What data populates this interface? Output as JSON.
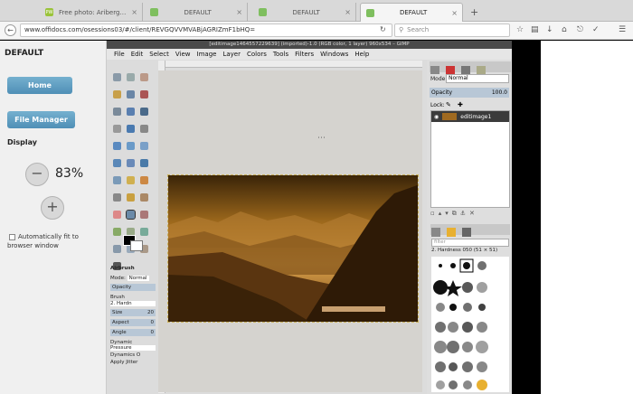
{
  "browser": {
    "tabs": [
      {
        "title": "Free photo: Ariberg Pass, L...",
        "favicon": "pw"
      },
      {
        "title": "DEFAULT",
        "favicon": "doc"
      },
      {
        "title": "DEFAULT",
        "favicon": "doc"
      },
      {
        "title": "DEFAULT",
        "favicon": "doc",
        "active": true
      }
    ],
    "new_tab_label": "+",
    "url": "www.offidocs.com/osessions03/#/client/REVGQVVMVABjAGRIZmF1bHQ=",
    "search_placeholder": "Search",
    "favicon_pw": "PW",
    "close_glyph": "×"
  },
  "panel": {
    "title": "DEFAULT",
    "home_label": "Home",
    "file_manager_label": "File Manager",
    "display_label": "Display",
    "zoom_minus": "−",
    "zoom_value": "83%",
    "zoom_plus": "+",
    "autofit_label": "Automatically fit to browser window"
  },
  "gimp": {
    "window_title": "[editimage1464557229639] (imported)-1.0 (RGB color, 1 layer) 960x534 – GIMP",
    "menu": [
      "File",
      "Edit",
      "Select",
      "View",
      "Image",
      "Layer",
      "Colors",
      "Tools",
      "Filters",
      "Windows",
      "Help"
    ],
    "tool_options_title": "Airbrush",
    "mode_label": "Mode:",
    "mode_value": "Normal",
    "opacity_label": "Opacity",
    "brush_label": "Brush",
    "brush_value": "2. Hardn",
    "size_label": "Size",
    "size_value": "20",
    "aspect_label": "Aspect",
    "aspect_value": "0",
    "angle_label": "Angle",
    "angle_value": "0",
    "dynamics_label": "Dynamic",
    "dynamics_value": "Pressure",
    "dynamics_options": "Dynamics O",
    "apply_jitter": "Apply Jitter",
    "layers": {
      "mode_label": "Mode:",
      "mode_value": "Normal",
      "opacity_label": "Opacity",
      "opacity_value": "100.0",
      "lock_label": "Lock:",
      "layer_name": "editimage1"
    },
    "brushes": {
      "filter_placeholder": "filter",
      "current": "2. Hardness 050 (51 × 51)"
    }
  },
  "colors": {
    "accent": "#5b9bc4",
    "gimp_title": "#4a4a4a"
  }
}
